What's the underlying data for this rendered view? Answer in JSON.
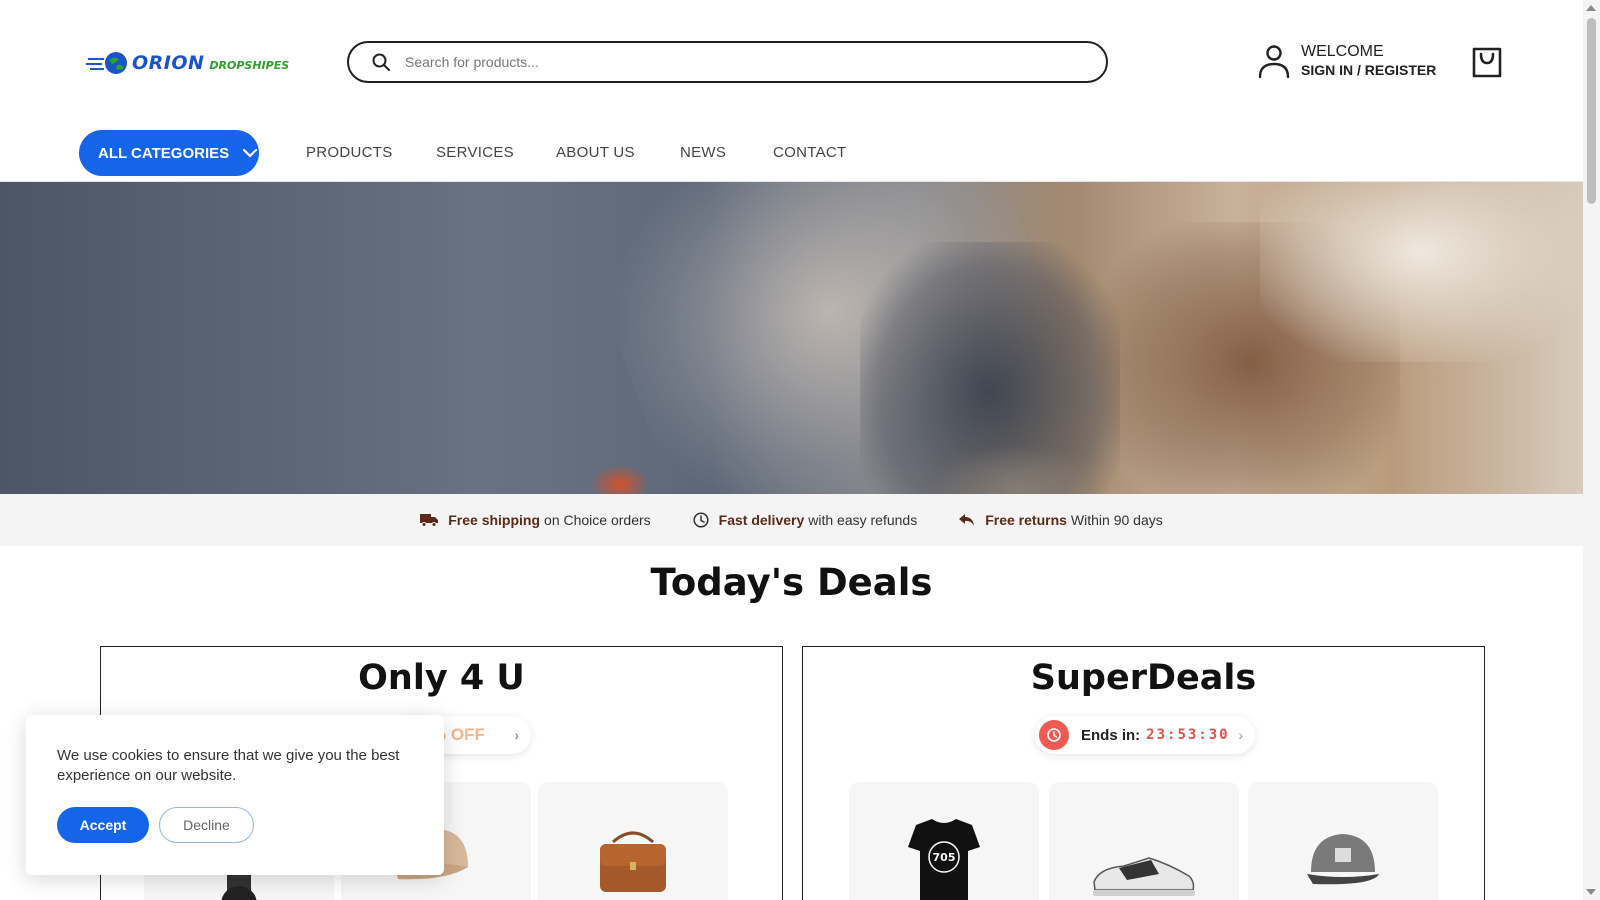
{
  "brand": {
    "logo_text": "ORION",
    "logo_sub": "DROPSHIPES"
  },
  "search": {
    "placeholder": "Search for products..."
  },
  "account": {
    "welcome": "WELCOME",
    "signin": "SIGN IN / REGISTER"
  },
  "nav": {
    "categories_label": "ALL CATEGORIES",
    "links": [
      "PRODUCTS",
      "SERVICES",
      "ABOUT US",
      "NEWS",
      "CONTACT"
    ]
  },
  "perks": [
    {
      "icon": "truck-icon",
      "bold": "Free shipping",
      "text": "on Choice orders"
    },
    {
      "icon": "clock-icon",
      "bold": "Fast delivery",
      "text": "with easy refunds"
    },
    {
      "icon": "return-arrow-icon",
      "bold": "Free returns",
      "text": "Within 90 days"
    }
  ],
  "deals": {
    "title": "Today's Deals",
    "cards": [
      {
        "title": "Only 4 U",
        "badge": "% OFF"
      },
      {
        "title": "SuperDeals",
        "ends_label": "Ends in:",
        "ends_time": "23:53:30"
      }
    ]
  },
  "cookie": {
    "message": "We use cookies to ensure that we give you the best experience on our website.",
    "accept": "Accept",
    "decline": "Decline"
  },
  "colors": {
    "accent": "#1565e8",
    "timer": "#e0524a",
    "logo_blue": "#1a55c8",
    "logo_green": "#2fa12f"
  }
}
